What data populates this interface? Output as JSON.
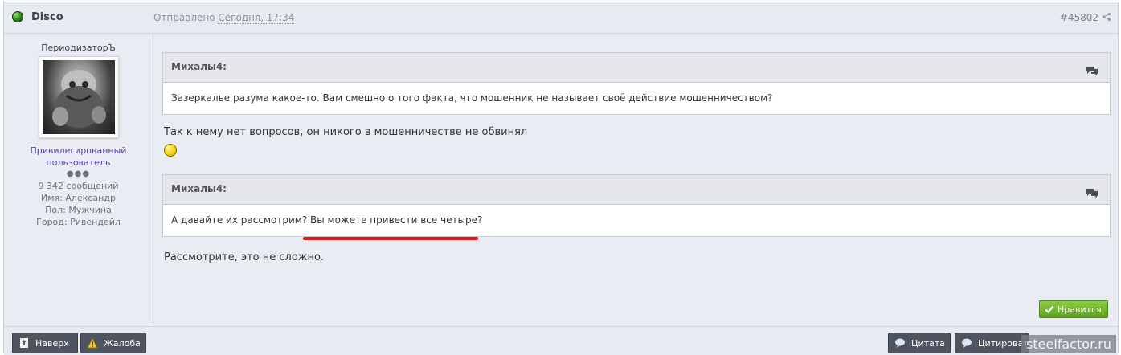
{
  "header": {
    "username": "Disco",
    "sent_prefix": "Отправлено",
    "sent_date": "Сегодня, 17:34",
    "post_id": "#45802"
  },
  "sidebar": {
    "name": "ПериодизаторЪ",
    "rank_line1": "Привилегированный",
    "rank_line2": "пользователь",
    "rank_dots": "●●●",
    "posts": "9 342 сообщений",
    "name_label": "Имя:",
    "name_value": "Александр",
    "gender_label": "Пол:",
    "gender_value": "Мужчина",
    "city_label": "Город:",
    "city_value": "Ривендейл"
  },
  "quotes": [
    {
      "author": "Михалы4:",
      "text": "Зазеркалье разума какое-то. Вам смешно о того факта, что мошенник не называет своё действие мошенничеством?"
    },
    {
      "author": "Михалы4:",
      "text": "А давайте их рассмотрим? Вы можете привести все четыре?"
    }
  ],
  "replies": [
    "Так к нему нет вопросов, он никого в мошенничестве не обвинял",
    "Рассмотрите, это не сложно."
  ],
  "like_button": "Нравится",
  "footer": {
    "top_button": "Наверх",
    "report_button": "Жалоба",
    "quote_button": "Цитата",
    "multiquote_button": "Цитировать"
  },
  "watermark": "steelfactor.ru",
  "colors": {
    "rank": "#5b3fb0",
    "like": "#6fb32e",
    "underline": "#e31414"
  }
}
